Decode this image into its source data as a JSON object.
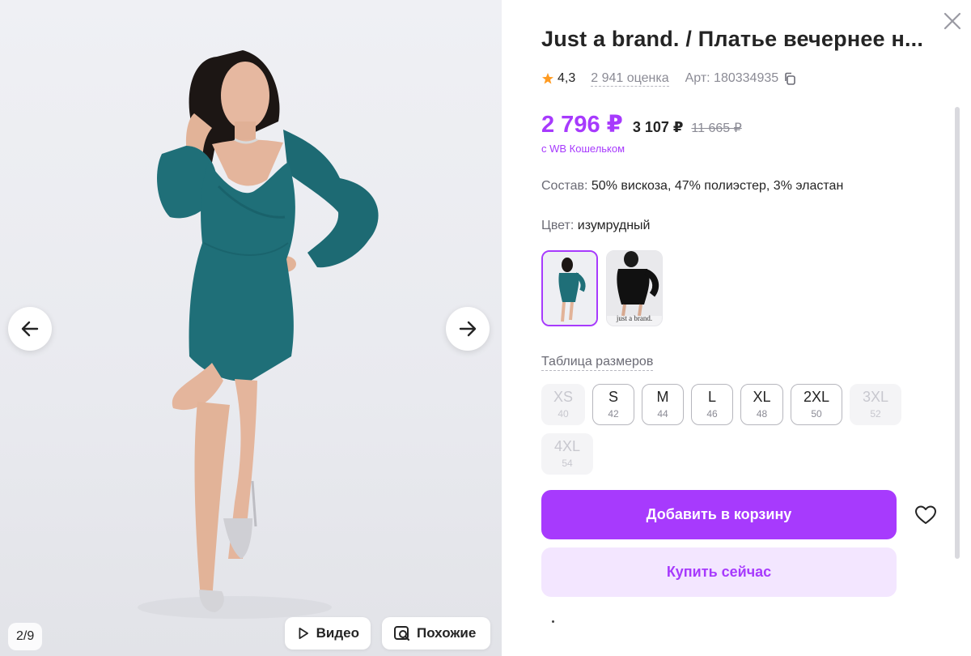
{
  "gallery": {
    "counter": "2/9",
    "video_label": "Видео",
    "similar_label": "Похожие",
    "thumb_caption": "just a brand."
  },
  "product": {
    "title": "Just a brand. / Платье вечернее н...",
    "rating": "4,3",
    "reviews": "2 941 оценка",
    "article": "Арт: 180334935",
    "price": "2 796 ₽",
    "price_old": "3 107 ₽",
    "price_strike": "11 665 ₽",
    "wallet_note": "с WB Кошельком",
    "composition_label": "Состав:",
    "composition_value": "50% вискоза, 47% полиэстер, 3% эластан",
    "color_label": "Цвет:",
    "color_value": "изумрудный",
    "size_table_label": "Таблица размеров"
  },
  "sizes": [
    {
      "size": "XS",
      "ru": "40",
      "available": false
    },
    {
      "size": "S",
      "ru": "42",
      "available": true
    },
    {
      "size": "M",
      "ru": "44",
      "available": true
    },
    {
      "size": "L",
      "ru": "46",
      "available": true
    },
    {
      "size": "XL",
      "ru": "48",
      "available": true
    },
    {
      "size": "2XL",
      "ru": "50",
      "available": true
    },
    {
      "size": "3XL",
      "ru": "52",
      "available": false
    },
    {
      "size": "4XL",
      "ru": "54",
      "available": false
    }
  ],
  "actions": {
    "add_to_cart": "Добавить в корзину",
    "buy_now": "Купить сейчас"
  },
  "colors": {
    "accent": "#a73afd",
    "accent_light": "#f3e6ff",
    "dress": "#1f6f78"
  }
}
